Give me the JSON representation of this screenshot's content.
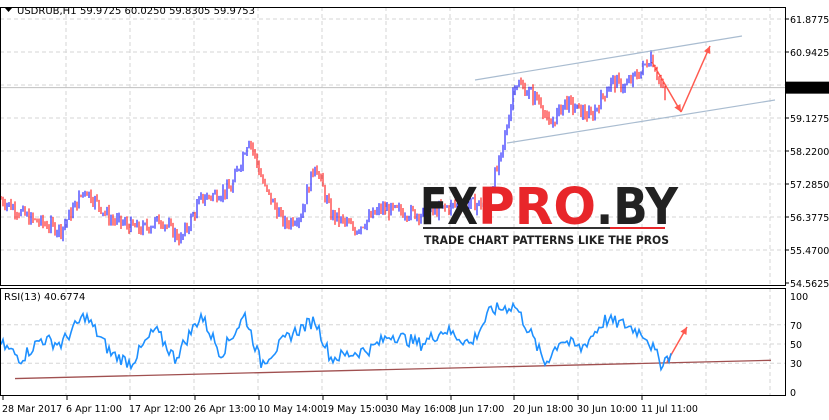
{
  "header": {
    "symbol": "USDRUB,H1",
    "ohlc": "59.9725 60.0250 59.8305 59.9753"
  },
  "rsi": {
    "label": "RSI(13) 40.6774"
  },
  "watermark": {
    "brand": "FXPRO.BY",
    "tagline": "TRADE CHART PATTERNS LIKE THE PROS"
  },
  "colors": {
    "up": "#0000ff",
    "down": "#ff0000",
    "channel": "#a9bcd0",
    "arrow": "#ff5a4f",
    "rsi": "#1e90ff",
    "trend": "#a05050"
  },
  "chart_data": [
    {
      "type": "candlestick",
      "title": "USDRUB,H1",
      "ylim": [
        54.5625,
        61.8775
      ],
      "y_ticks": [
        "61.8775",
        "60.9425",
        "59.9753",
        "59.1275",
        "58.2200",
        "57.2850",
        "56.3775",
        "55.4700",
        "54.5625"
      ],
      "current_price": "59.9753",
      "x_ticks": [
        "28 Mar 2017",
        "6 Apr 11:00",
        "17 Apr 12:00",
        "26 Apr 13:00",
        "10 May 14:00",
        "19 May 15:00",
        "30 May 16:00",
        "8 Jun 17:00",
        "20 Jun 18:00",
        "30 Jun 10:00",
        "11 Jul 11:00"
      ],
      "close_keypoints": [
        [
          0,
          56.89
        ],
        [
          15,
          56.32
        ],
        [
          30,
          56.04
        ],
        [
          42,
          57.17
        ],
        [
          55,
          56.32
        ],
        [
          70,
          56.04
        ],
        [
          80,
          56.32
        ],
        [
          90,
          55.76
        ],
        [
          100,
          56.89
        ],
        [
          115,
          57.17
        ],
        [
          124,
          58.59
        ],
        [
          132,
          57.17
        ],
        [
          142,
          56.18
        ],
        [
          150,
          56.47
        ],
        [
          157,
          57.88
        ],
        [
          165,
          56.47
        ],
        [
          177,
          56.04
        ],
        [
          190,
          56.61
        ],
        [
          210,
          56.47
        ],
        [
          230,
          56.75
        ],
        [
          242,
          56.75
        ],
        [
          250,
          58.02
        ],
        [
          257,
          60.15
        ],
        [
          270,
          59.58
        ],
        [
          274,
          58.87
        ],
        [
          282,
          59.58
        ],
        [
          295,
          59.16
        ],
        [
          305,
          60.15
        ],
        [
          312,
          60.01
        ],
        [
          320,
          60.43
        ],
        [
          325,
          60.86
        ],
        [
          332,
          59.72
        ]
      ],
      "channel": {
        "upper": [
          [
            237,
            60.15
          ],
          [
            371,
            61.4
          ]
        ],
        "lower": [
          [
            253,
            58.38
          ],
          [
            387,
            59.6
          ]
        ]
      }
    },
    {
      "type": "line",
      "title": "RSI(13)",
      "ylim": [
        0,
        100
      ],
      "y_ticks": [
        "100",
        "70",
        "50",
        "30",
        "0"
      ],
      "value_keypoints": [
        [
          0,
          50
        ],
        [
          10,
          35
        ],
        [
          20,
          55
        ],
        [
          30,
          50
        ],
        [
          42,
          80
        ],
        [
          55,
          40
        ],
        [
          65,
          30
        ],
        [
          77,
          65
        ],
        [
          87,
          35
        ],
        [
          100,
          80
        ],
        [
          110,
          40
        ],
        [
          122,
          80
        ],
        [
          130,
          30
        ],
        [
          145,
          60
        ],
        [
          157,
          75
        ],
        [
          165,
          35
        ],
        [
          175,
          40
        ],
        [
          185,
          45
        ],
        [
          195,
          60
        ],
        [
          210,
          50
        ],
        [
          222,
          65
        ],
        [
          235,
          50
        ],
        [
          245,
          85
        ],
        [
          257,
          90
        ],
        [
          265,
          60
        ],
        [
          272,
          30
        ],
        [
          280,
          55
        ],
        [
          290,
          45
        ],
        [
          302,
          75
        ],
        [
          312,
          70
        ],
        [
          322,
          60
        ],
        [
          330,
          30
        ],
        [
          335,
          40
        ]
      ],
      "trendline": [
        [
          7,
          14
        ],
        [
          385,
          33
        ]
      ]
    }
  ]
}
